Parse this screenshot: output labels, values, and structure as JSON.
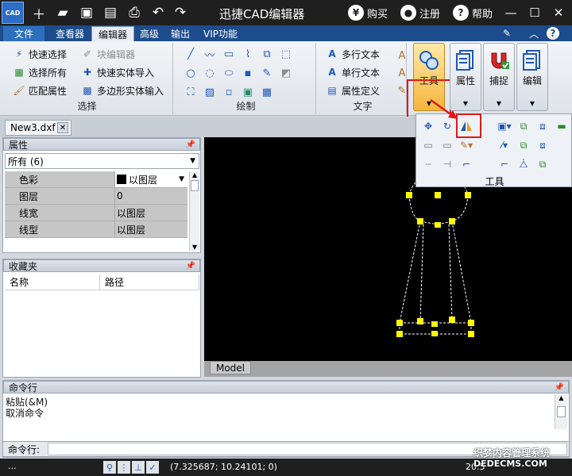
{
  "titlebar": {
    "logo_text": "CAD",
    "title": "迅捷CAD编辑器",
    "buy_label": "购买",
    "register_label": "注册",
    "help_label": "帮助",
    "buy_icon": "yen-icon",
    "register_icon": "user-icon",
    "help_icon": "question-icon",
    "quick_access": [
      "new-icon",
      "open-folder-icon",
      "save-icon",
      "save-as-icon",
      "print-icon",
      "undo-icon",
      "redo-icon"
    ]
  },
  "menu": {
    "file": "文件",
    "tabs": [
      "查看器",
      "编辑器",
      "高级",
      "输出",
      "VIP功能"
    ],
    "active_tab": "编辑器"
  },
  "ribbon": {
    "select_group": {
      "title": "选择",
      "items": [
        "快速选择",
        "选择所有",
        "匹配属性",
        "块编辑器",
        "快速实体导入",
        "多边形实体输入"
      ],
      "disabled": [
        "块编辑器"
      ]
    },
    "draw_group": {
      "title": "绘制"
    },
    "text_group": {
      "title": "文字",
      "items": [
        "多行文本",
        "单行文本",
        "属性定义"
      ]
    },
    "big_buttons": [
      "工具",
      "属性",
      "捕捉",
      "编辑"
    ],
    "active_big_button": "工具"
  },
  "tools_dropdown": {
    "title": "工具",
    "highlighted_tool": "mirror-icon"
  },
  "document": {
    "tab_name": "New3.dxf",
    "model_tab": "Model"
  },
  "properties_panel": {
    "title": "属性",
    "selection": "所有 (6)",
    "rows": [
      {
        "key": "色彩",
        "value": "以图层"
      },
      {
        "key": "图层",
        "value": "0"
      },
      {
        "key": "线宽",
        "value": "以图层"
      },
      {
        "key": "线型",
        "value": "以图层"
      }
    ]
  },
  "favorites_panel": {
    "title": "收藏夹",
    "columns": [
      "名称",
      "路径"
    ]
  },
  "command_panel": {
    "title": "命令行",
    "lines": [
      "粘贴(&M)",
      "取消命令"
    ],
    "input_label": "命令行:"
  },
  "statusbar": {
    "dots": "...",
    "coordinates": "(7.325687; 10.24101; 0)",
    "version": "20.5",
    "watermark": [
      "织梦内容管理系统",
      "DEDECMS.COM"
    ]
  },
  "colors": {
    "titlebar_bg": "#1f1f1f",
    "menubar_bg": "#1d4c8c",
    "canvas_bg": "#000000",
    "grip_yellow": "#ffff00",
    "highlight_red": "#e01818",
    "active_button": "#f5b53c"
  }
}
